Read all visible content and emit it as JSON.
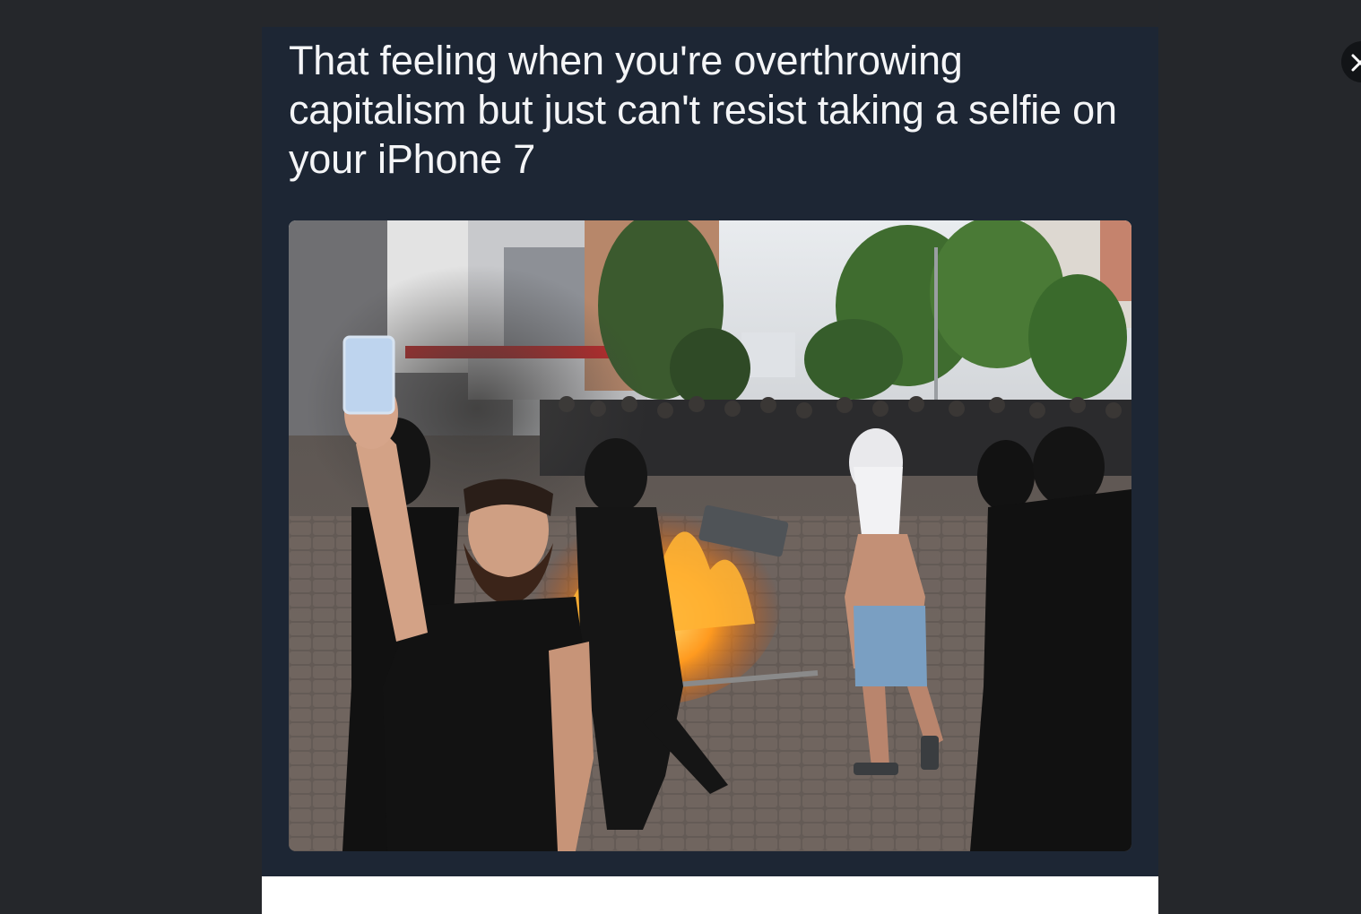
{
  "tweet": {
    "caption": "That feeling when you're overthrowing capitalism but just can't resist taking a selfie on your iPhone 7"
  },
  "photo": {
    "icon": "photo-icon",
    "alt": ""
  },
  "viewer": {
    "close_icon": "close-icon"
  },
  "colors": {
    "page_background": "#25272b",
    "card_background": "#1d2634",
    "caption_text": "#f4f5f7",
    "close_button": "#121417"
  }
}
